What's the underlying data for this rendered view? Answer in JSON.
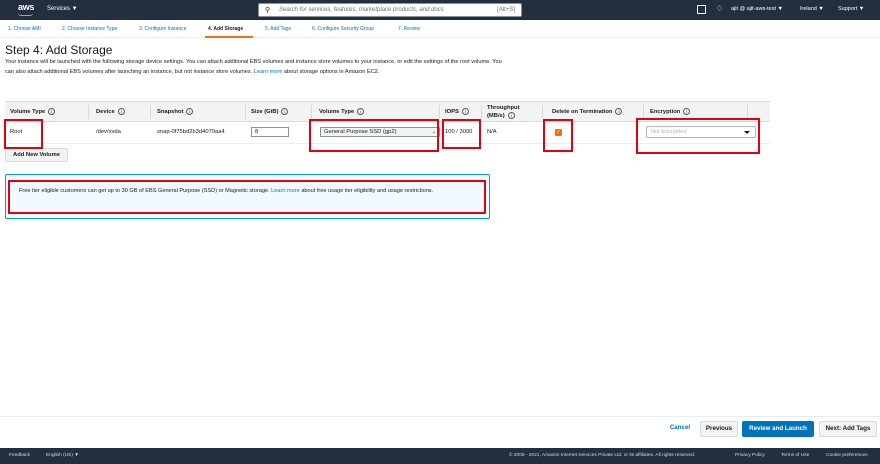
{
  "topnav": {
    "logo": "aws",
    "services": "Services ▼",
    "search_placeholder": "Search for services, features, marketplace products, and docs",
    "search_shortcut": "[Alt+S]",
    "user": "ajit @ ajit-aws-test ▼",
    "region": "Ireland ▼",
    "support": "Support ▼"
  },
  "steps": [
    "1. Choose AMI",
    "2. Choose Instance Type",
    "3. Configure Instance",
    "4. Add Storage",
    "5. Add Tags",
    "6. Configure Security Group",
    "7. Review"
  ],
  "page": {
    "title": "Step 4: Add Storage",
    "desc_main": "Your instance will be launched with the following storage device settings. You can attach additional EBS volumes and instance store volumes to your instance, or edit the settings of the root volume. You can also attach additional EBS volumes after launching an instance, but not instance store volumes. ",
    "desc_link": "Learn more",
    "desc_tail": " about storage options in Amazon EC2."
  },
  "table": {
    "headers": {
      "volume_type": "Volume Type",
      "device": "Device",
      "snapshot": "Snapshot",
      "size": "Size (GiB)",
      "volume_type2": "Volume Type",
      "iops": "IOPS",
      "throughput_1": "Throughput",
      "throughput_2": "(MB/s)",
      "delete": "Delete on Termination",
      "encryption": "Encryption"
    },
    "row": {
      "volume_type": "Root",
      "device": "/dev/xvda",
      "snapshot": "snap-0f75bd2b3d4079aa4",
      "size": "8",
      "volume_type2": "General Purpose SSD (gp2)",
      "iops": "100 / 3000",
      "throughput": "N/A",
      "delete_checked": true,
      "encryption": "Not Encrypted"
    },
    "info_glyph": "i"
  },
  "add_volume_label": "Add New Volume",
  "infobox": {
    "text_main": "Free tier eligible customers can get up to 30 GB of EBS General Purpose (SSD) or Magnetic storage. ",
    "link": "Learn more",
    "text_tail": " about free usage tier eligibility and usage restrictions."
  },
  "footer_buttons": {
    "cancel": "Cancel",
    "previous": "Previous",
    "review": "Review and Launch",
    "next": "Next: Add Tags"
  },
  "bottombar": {
    "feedback": "Feedback",
    "language": "English (US) ▼",
    "copyright": "© 2008 - 2021, Amazon Internet Services Private Ltd. or its affiliates. All rights reserved.",
    "privacy": "Privacy Policy",
    "terms": "Terms of Use",
    "cookies": "Cookie preferences"
  },
  "colors": {
    "nav_bg": "#232f3e",
    "accent": "#ec7211",
    "link": "#0073bb",
    "highlight": "#e3000f"
  }
}
